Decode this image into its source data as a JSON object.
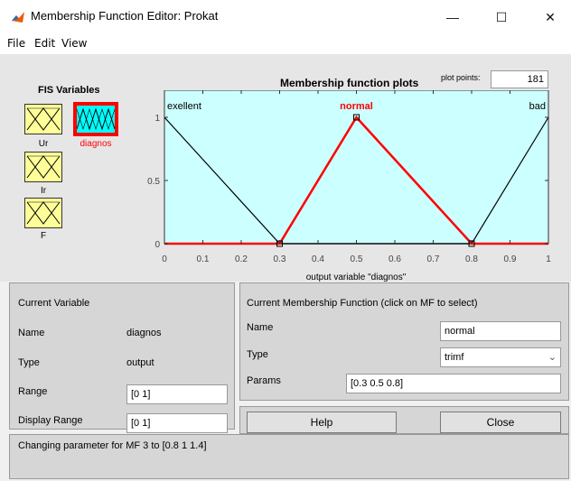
{
  "window": {
    "title": "Membership Function Editor: Prokat",
    "minimize": "—",
    "maximize": "☐",
    "close": "✕"
  },
  "menu": [
    "File",
    "Edit",
    "View"
  ],
  "fis": {
    "title": "FIS Variables",
    "variables": [
      {
        "name": "Ur",
        "type": "input",
        "selected": false
      },
      {
        "name": "diagnos",
        "type": "output",
        "selected": true
      },
      {
        "name": "Ir",
        "type": "input",
        "selected": false
      },
      {
        "name": "F",
        "type": "input",
        "selected": false
      }
    ]
  },
  "plot": {
    "title": "Membership function plots",
    "points_label": "plot points:",
    "points_value": "181",
    "xlabel": "output variable \"diagnos\""
  },
  "chart_data": {
    "type": "line",
    "title": "Membership function plots",
    "xlabel": "output variable \"diagnos\"",
    "ylabel": "",
    "xlim": [
      0,
      1
    ],
    "ylim": [
      0,
      1
    ],
    "x_ticks": [
      "0",
      "0.1",
      "0.2",
      "0.3",
      "0.4",
      "0.5",
      "0.6",
      "0.7",
      "0.8",
      "0.9",
      "1"
    ],
    "y_ticks": [
      "0",
      "0.5",
      "1"
    ],
    "series": [
      {
        "name": "exellent",
        "color": "#000000",
        "selected": false,
        "x": [
          0,
          0.3,
          1
        ],
        "y": [
          1,
          0,
          0
        ]
      },
      {
        "name": "normal",
        "color": "#ff0000",
        "selected": true,
        "x": [
          0,
          0.3,
          0.5,
          0.8,
          1
        ],
        "y": [
          0,
          0,
          1,
          0,
          0
        ]
      },
      {
        "name": "bad",
        "color": "#000000",
        "selected": false,
        "x": [
          0,
          0.8,
          1
        ],
        "y": [
          0,
          0,
          1
        ]
      }
    ]
  },
  "current_variable": {
    "title": "Current Variable",
    "name_label": "Name",
    "name_value": "diagnos",
    "type_label": "Type",
    "type_value": "output",
    "range_label": "Range",
    "range_value": "[0 1]",
    "display_range_label": "Display Range",
    "display_range_value": "[0 1]"
  },
  "current_mf": {
    "title": "Current Membership Function (click on MF to select)",
    "name_label": "Name",
    "name_value": "normal",
    "type_label": "Type",
    "type_value": "trimf",
    "params_label": "Params",
    "params_value": "[0.3 0.5 0.8]"
  },
  "buttons": {
    "help": "Help",
    "close": "Close"
  },
  "status": "Changing parameter for MF 3 to  [0.8 1 1.4]",
  "colors": {
    "plot_bg": "#ccffff",
    "var_box": "#ffff99",
    "selected": "#ff0000",
    "output_var": "#00ffff"
  }
}
